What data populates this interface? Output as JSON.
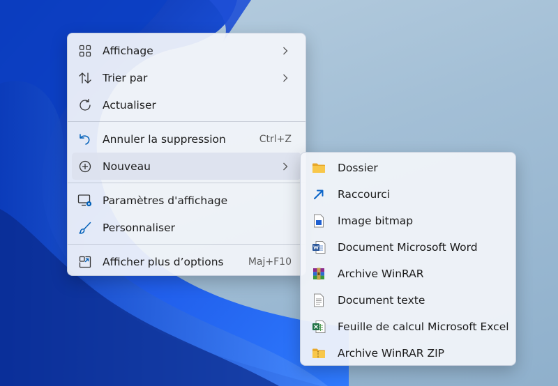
{
  "context_menu": {
    "items": [
      {
        "label": "Affichage",
        "icon": "grid-view-icon",
        "submenu": true
      },
      {
        "label": "Trier par",
        "icon": "sort-arrows-icon",
        "submenu": true
      },
      {
        "label": "Actualiser",
        "icon": "refresh-icon"
      },
      {
        "label": "Annuler la suppression",
        "icon": "undo-icon",
        "shortcut": "Ctrl+Z"
      },
      {
        "label": "Nouveau",
        "icon": "add-circle-icon",
        "submenu": true,
        "active": true
      },
      {
        "label": "Paramètres d'affichage",
        "icon": "display-settings-icon"
      },
      {
        "label": "Personnaliser",
        "icon": "brush-icon"
      },
      {
        "label": "Afficher plus d’options",
        "icon": "more-options-icon",
        "shortcut": "Maj+F10"
      }
    ]
  },
  "new_submenu": {
    "items": [
      {
        "label": "Dossier",
        "icon": "folder-icon"
      },
      {
        "label": "Raccourci",
        "icon": "shortcut-arrow-icon"
      },
      {
        "label": "Image bitmap",
        "icon": "bitmap-file-icon"
      },
      {
        "label": "Document Microsoft Word",
        "icon": "word-document-icon"
      },
      {
        "label": "Archive WinRAR",
        "icon": "winrar-archive-icon"
      },
      {
        "label": "Document texte",
        "icon": "text-document-icon"
      },
      {
        "label": "Feuille de calcul Microsoft Excel",
        "icon": "excel-sheet-icon"
      },
      {
        "label": "Archive WinRAR ZIP",
        "icon": "zip-folder-icon"
      }
    ]
  },
  "colors": {
    "accent": "#005fb8",
    "wallpaper_blue": "#1d4ed8",
    "folder": "#f6c343",
    "word": "#2b579a",
    "excel": "#217346"
  }
}
